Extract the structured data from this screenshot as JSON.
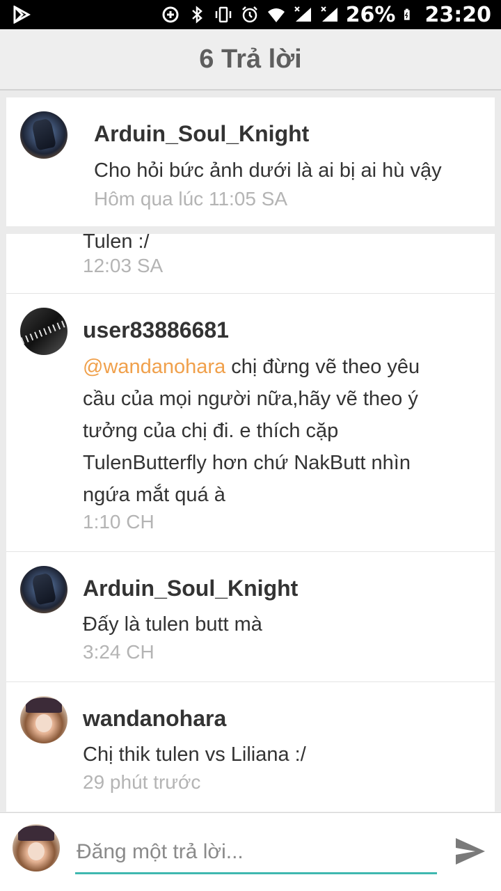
{
  "status_bar": {
    "battery": "26%",
    "time": "23:20",
    "icons": [
      "play-store-icon",
      "data-saver-icon",
      "bluetooth-icon",
      "vibrate-icon",
      "alarm-icon",
      "wifi-icon",
      "signal-icon",
      "signal-icon",
      "battery-charging-icon"
    ]
  },
  "header": {
    "title": "6 Trả lời"
  },
  "original_post": {
    "username": "Arduin_Soul_Knight",
    "message": "Cho hỏi bức ảnh dưới là ai bị ai hù vậy",
    "time": "Hôm qua lúc 11:05 SA"
  },
  "partial_reply": {
    "message": "Tulen :/",
    "time": "12:03 SA"
  },
  "replies": [
    {
      "username": "user83886681",
      "mention": "@wandanohara",
      "message": " chị đừng vẽ theo yêu cầu của mọi người nữa,hãy vẽ theo ý tưởng của chị đi. e thích cặp TulenButterfly hơn chứ NakButt nhìn ngứa mắt quá à",
      "time": "1:10 CH"
    },
    {
      "username": "Arduin_Soul_Knight",
      "message": "Đấy là tulen butt mà",
      "time": "3:24 CH"
    },
    {
      "username": "wandanohara",
      "message": "Chị thik tulen vs Liliana :/",
      "time": "29 phút trước"
    }
  ],
  "composer": {
    "placeholder": "Đăng một trả lời..."
  },
  "colors": {
    "mention": "#f0a04b",
    "accent_underline": "#3fb8b0",
    "header_text": "#5e5e5e",
    "muted": "#b4b4b4"
  }
}
